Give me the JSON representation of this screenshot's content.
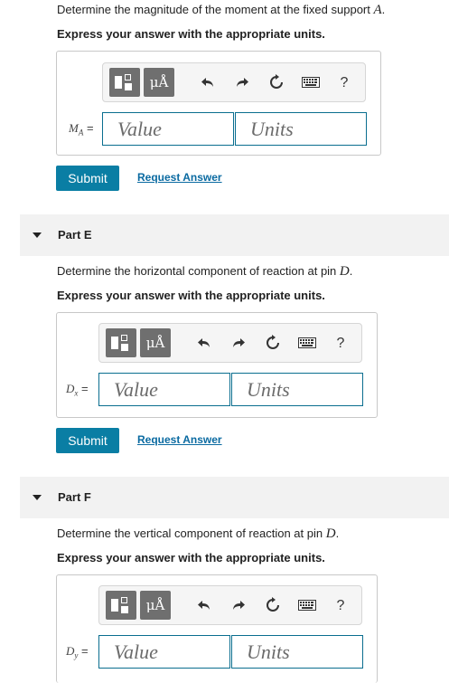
{
  "part_d": {
    "question": "Determine the magnitude of the moment at the fixed support ",
    "question_var": "A",
    "question_end": ".",
    "instruction": "Express your answer with the appropriate units.",
    "label_main": "M",
    "label_sub": "A",
    "label_eq": " =",
    "value_placeholder": "Value",
    "units_placeholder": "Units",
    "submit_label": "Submit",
    "request_label": "Request Answer"
  },
  "part_e": {
    "title": "Part E",
    "question": "Determine the horizontal component of reaction at pin ",
    "question_var": "D",
    "question_end": ".",
    "instruction": "Express your answer with the appropriate units.",
    "label_main": "D",
    "label_sub": "x",
    "label_eq": " =",
    "value_placeholder": "Value",
    "units_placeholder": "Units",
    "submit_label": "Submit",
    "request_label": "Request Answer"
  },
  "part_f": {
    "title": "Part F",
    "question": "Determine the vertical component of reaction at pin ",
    "question_var": "D",
    "question_end": ".",
    "instruction": "Express your answer with the appropriate units.",
    "label_main": "D",
    "label_sub": "y",
    "label_eq": " =",
    "value_placeholder": "Value",
    "units_placeholder": "Units"
  },
  "toolbar": {
    "units_button_label": "μÅ",
    "help_label": "?"
  },
  "colors": {
    "accent": "#0a7ea4",
    "field_border": "#0a6e8f",
    "link": "#0a6aa1",
    "part_bar": "#f2f2f2"
  },
  "icons": [
    "templates-icon",
    "units-icon",
    "undo-icon",
    "redo-icon",
    "reset-icon",
    "keyboard-icon",
    "help-icon",
    "caret-down-icon"
  ]
}
